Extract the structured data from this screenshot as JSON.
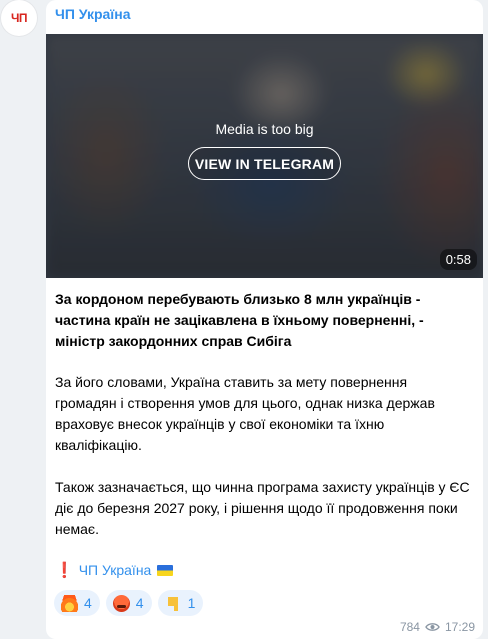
{
  "channel": {
    "name": "ЧП Україна",
    "avatar_text": "ЧП"
  },
  "media": {
    "notice": "Media is too big",
    "button_label": "VIEW IN TELEGRAM",
    "duration": "0:58"
  },
  "post": {
    "headline": "За кордоном перебувають близько 8 млн українців - частина країн не зацікавлена в їхньому поверненні, - міністр закордонних справ Сибіга",
    "paragraph1": "За його словами, Україна ставить за мету повернення громадян і створення умов для цього, однак низка держав враховує внесок українців у свої економіки та їхню кваліфікацію.",
    "paragraph2": "Також зазначається, що чинна програма захисту українців у ЄС діє до березня 2027 року, і рішення щодо її продовження поки немає.",
    "signature_mark": "❗",
    "signature": "ЧП Україна"
  },
  "reactions": [
    {
      "icon": "fire-emoji-icon",
      "count": "4"
    },
    {
      "icon": "angry-face-emoji-icon",
      "count": "4"
    },
    {
      "icon": "thumbs-down-emoji-icon",
      "count": "1"
    }
  ],
  "footer": {
    "views": "784",
    "time": "17:29"
  },
  "colors": {
    "accent": "#3390ec",
    "background": "#eef1f4",
    "card": "#ffffff",
    "meta": "#8a96a3"
  }
}
